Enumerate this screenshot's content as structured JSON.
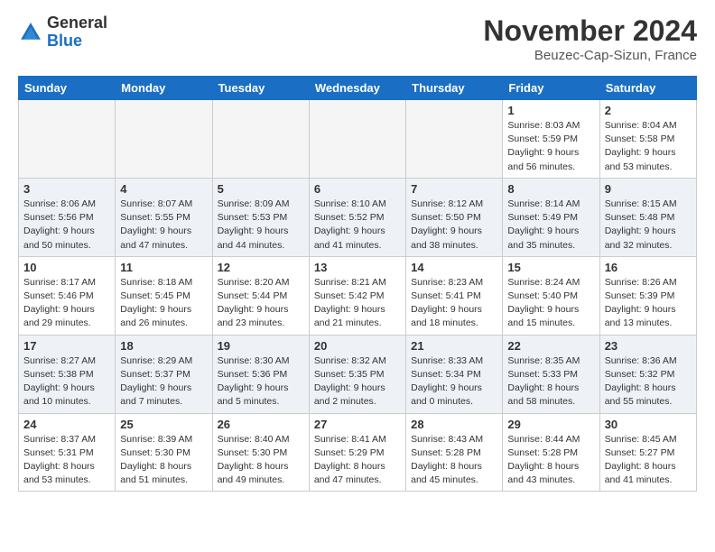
{
  "logo": {
    "general": "General",
    "blue": "Blue"
  },
  "header": {
    "month_year": "November 2024",
    "location": "Beuzec-Cap-Sizun, France"
  },
  "weekdays": [
    "Sunday",
    "Monday",
    "Tuesday",
    "Wednesday",
    "Thursday",
    "Friday",
    "Saturday"
  ],
  "weeks": [
    [
      {
        "day": "",
        "info": ""
      },
      {
        "day": "",
        "info": ""
      },
      {
        "day": "",
        "info": ""
      },
      {
        "day": "",
        "info": ""
      },
      {
        "day": "",
        "info": ""
      },
      {
        "day": "1",
        "info": "Sunrise: 8:03 AM\nSunset: 5:59 PM\nDaylight: 9 hours and 56 minutes."
      },
      {
        "day": "2",
        "info": "Sunrise: 8:04 AM\nSunset: 5:58 PM\nDaylight: 9 hours and 53 minutes."
      }
    ],
    [
      {
        "day": "3",
        "info": "Sunrise: 8:06 AM\nSunset: 5:56 PM\nDaylight: 9 hours and 50 minutes."
      },
      {
        "day": "4",
        "info": "Sunrise: 8:07 AM\nSunset: 5:55 PM\nDaylight: 9 hours and 47 minutes."
      },
      {
        "day": "5",
        "info": "Sunrise: 8:09 AM\nSunset: 5:53 PM\nDaylight: 9 hours and 44 minutes."
      },
      {
        "day": "6",
        "info": "Sunrise: 8:10 AM\nSunset: 5:52 PM\nDaylight: 9 hours and 41 minutes."
      },
      {
        "day": "7",
        "info": "Sunrise: 8:12 AM\nSunset: 5:50 PM\nDaylight: 9 hours and 38 minutes."
      },
      {
        "day": "8",
        "info": "Sunrise: 8:14 AM\nSunset: 5:49 PM\nDaylight: 9 hours and 35 minutes."
      },
      {
        "day": "9",
        "info": "Sunrise: 8:15 AM\nSunset: 5:48 PM\nDaylight: 9 hours and 32 minutes."
      }
    ],
    [
      {
        "day": "10",
        "info": "Sunrise: 8:17 AM\nSunset: 5:46 PM\nDaylight: 9 hours and 29 minutes."
      },
      {
        "day": "11",
        "info": "Sunrise: 8:18 AM\nSunset: 5:45 PM\nDaylight: 9 hours and 26 minutes."
      },
      {
        "day": "12",
        "info": "Sunrise: 8:20 AM\nSunset: 5:44 PM\nDaylight: 9 hours and 23 minutes."
      },
      {
        "day": "13",
        "info": "Sunrise: 8:21 AM\nSunset: 5:42 PM\nDaylight: 9 hours and 21 minutes."
      },
      {
        "day": "14",
        "info": "Sunrise: 8:23 AM\nSunset: 5:41 PM\nDaylight: 9 hours and 18 minutes."
      },
      {
        "day": "15",
        "info": "Sunrise: 8:24 AM\nSunset: 5:40 PM\nDaylight: 9 hours and 15 minutes."
      },
      {
        "day": "16",
        "info": "Sunrise: 8:26 AM\nSunset: 5:39 PM\nDaylight: 9 hours and 13 minutes."
      }
    ],
    [
      {
        "day": "17",
        "info": "Sunrise: 8:27 AM\nSunset: 5:38 PM\nDaylight: 9 hours and 10 minutes."
      },
      {
        "day": "18",
        "info": "Sunrise: 8:29 AM\nSunset: 5:37 PM\nDaylight: 9 hours and 7 minutes."
      },
      {
        "day": "19",
        "info": "Sunrise: 8:30 AM\nSunset: 5:36 PM\nDaylight: 9 hours and 5 minutes."
      },
      {
        "day": "20",
        "info": "Sunrise: 8:32 AM\nSunset: 5:35 PM\nDaylight: 9 hours and 2 minutes."
      },
      {
        "day": "21",
        "info": "Sunrise: 8:33 AM\nSunset: 5:34 PM\nDaylight: 9 hours and 0 minutes."
      },
      {
        "day": "22",
        "info": "Sunrise: 8:35 AM\nSunset: 5:33 PM\nDaylight: 8 hours and 58 minutes."
      },
      {
        "day": "23",
        "info": "Sunrise: 8:36 AM\nSunset: 5:32 PM\nDaylight: 8 hours and 55 minutes."
      }
    ],
    [
      {
        "day": "24",
        "info": "Sunrise: 8:37 AM\nSunset: 5:31 PM\nDaylight: 8 hours and 53 minutes."
      },
      {
        "day": "25",
        "info": "Sunrise: 8:39 AM\nSunset: 5:30 PM\nDaylight: 8 hours and 51 minutes."
      },
      {
        "day": "26",
        "info": "Sunrise: 8:40 AM\nSunset: 5:30 PM\nDaylight: 8 hours and 49 minutes."
      },
      {
        "day": "27",
        "info": "Sunrise: 8:41 AM\nSunset: 5:29 PM\nDaylight: 8 hours and 47 minutes."
      },
      {
        "day": "28",
        "info": "Sunrise: 8:43 AM\nSunset: 5:28 PM\nDaylight: 8 hours and 45 minutes."
      },
      {
        "day": "29",
        "info": "Sunrise: 8:44 AM\nSunset: 5:28 PM\nDaylight: 8 hours and 43 minutes."
      },
      {
        "day": "30",
        "info": "Sunrise: 8:45 AM\nSunset: 5:27 PM\nDaylight: 8 hours and 41 minutes."
      }
    ]
  ]
}
